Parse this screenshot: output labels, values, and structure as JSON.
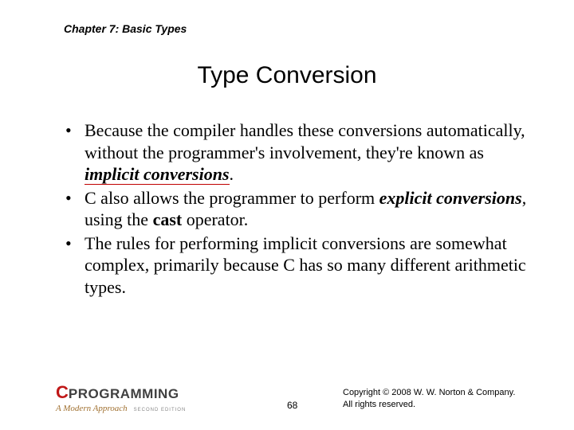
{
  "chapter": "Chapter 7: Basic Types",
  "title": "Type Conversion",
  "bullets": [
    {
      "pre": "Because the compiler handles these conversions automatically, without the programmer's involvement, they're known as ",
      "term": "implicit conversions",
      "term_class": "implicit",
      "post": "."
    },
    {
      "pre": "C also allows the programmer to perform ",
      "term": "explicit conversions",
      "term_class": "explicit",
      "mid": ", using the ",
      "term2": "cast",
      "term2_class": "cast",
      "post": " operator."
    },
    {
      "pre": "The rules for performing implicit conversions are somewhat complex, primarily because C has so many different arithmetic types.",
      "term": "",
      "post": ""
    }
  ],
  "bullet_marker": "•",
  "logo": {
    "c": "C",
    "prog": "PROGRAMMING",
    "sub": "A Modern Approach",
    "ed": "SECOND EDITION"
  },
  "page_number": "68",
  "copyright_line1": "Copyright © 2008 W. W. Norton & Company.",
  "copyright_line2": "All rights reserved."
}
